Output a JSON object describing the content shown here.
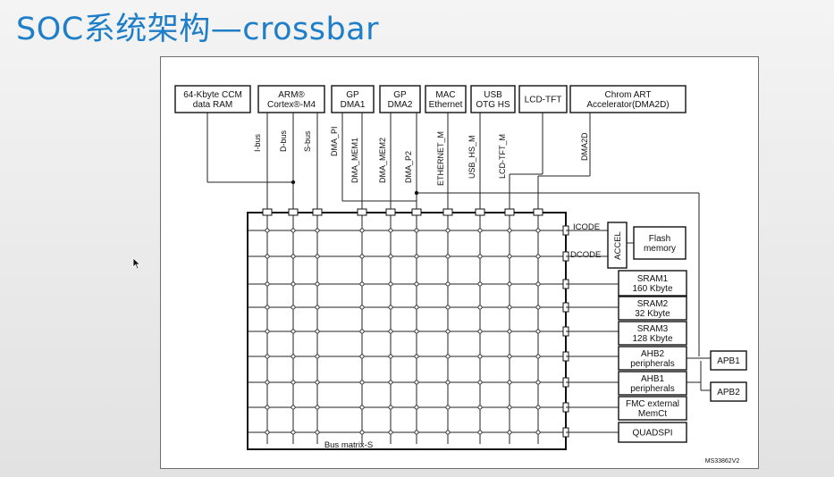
{
  "slide": {
    "title": "SOC系统架构—crossbar"
  },
  "diagram": {
    "masters": [
      {
        "lines": [
          "64-Kbyte CCM",
          "data RAM"
        ]
      },
      {
        "lines": [
          "ARM®",
          "Cortex®-M4"
        ]
      },
      {
        "lines": [
          "GP",
          "DMA1"
        ]
      },
      {
        "lines": [
          "GP",
          "DMA2"
        ]
      },
      {
        "lines": [
          "MAC",
          "Ethernet"
        ]
      },
      {
        "lines": [
          "USB",
          "OTG HS"
        ]
      },
      {
        "lines": [
          "LCD-TFT"
        ]
      },
      {
        "lines": [
          "Chrom ART",
          "Accelerator(DMA2D)"
        ]
      }
    ],
    "bus_labels": [
      "I-bus",
      "D-bus",
      "S-bus",
      "DMA_PI",
      "DMA_MEM1",
      "DMA_MEM2",
      "DMA_P2",
      "ETHERNET_M",
      "USB_HS_M",
      "LCD-TFT_M",
      "DMA2D"
    ],
    "slaves": [
      {
        "lines": [
          "SRAM1",
          "160 Kbyte"
        ]
      },
      {
        "lines": [
          "SRAM2",
          "32 Kbyte"
        ]
      },
      {
        "lines": [
          "SRAM3",
          "128 Kbyte"
        ]
      },
      {
        "lines": [
          "AHB2",
          "peripherals"
        ]
      },
      {
        "lines": [
          "AHB1",
          "peripherals"
        ]
      },
      {
        "lines": [
          "FMC external",
          "MemCt"
        ]
      },
      {
        "lines": [
          "QUADSPI"
        ]
      }
    ],
    "icode_label": "ICODE",
    "dcode_label": "DCODE",
    "accel_label": "ACCEL",
    "flash": {
      "lines": [
        "Flash",
        "memory"
      ]
    },
    "apb": [
      "APB1",
      "APB2"
    ],
    "matrix_label": "Bus matrix-S",
    "figure_id": "MS33862V2"
  }
}
